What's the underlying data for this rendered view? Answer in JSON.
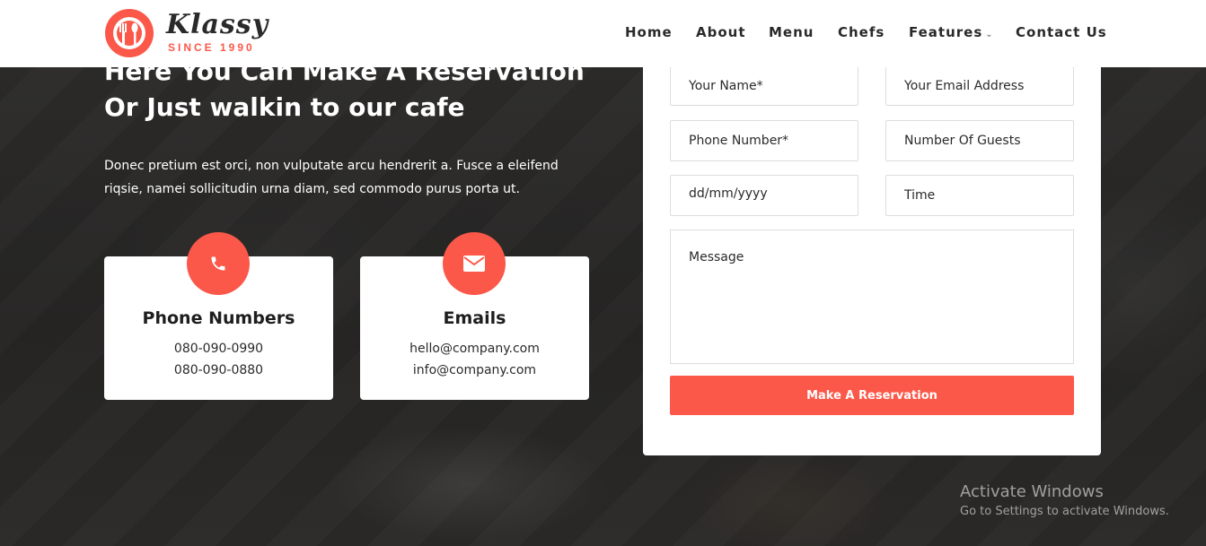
{
  "colors": {
    "accent": "#fb5849",
    "dark": "#2a2a2a",
    "white": "#ffffff"
  },
  "logo": {
    "name": "Klassy",
    "since": "SINCE 1990",
    "icon": "plate-fork-spoon-icon"
  },
  "nav": {
    "items": [
      {
        "label": "Home"
      },
      {
        "label": "About"
      },
      {
        "label": "Menu"
      },
      {
        "label": "Chefs"
      },
      {
        "label": "Features",
        "dropdown": true,
        "icon": "chevron-down-icon"
      },
      {
        "label": "Contact Us"
      }
    ]
  },
  "reservation": {
    "heading_line1": "Here You Can Make A Reservation",
    "heading_line2": "Or Just walkin to our cafe",
    "desc_line1": "Donec pretium est orci, non vulputate arcu hendrerit a. Fusce a eleifend",
    "desc_line2": "riqsie, namei sollicitudin urna diam, sed commodo purus porta ut."
  },
  "cards": [
    {
      "icon": "phone-icon",
      "title": "Phone Numbers",
      "lines": [
        "080-090-0990",
        "080-090-0880"
      ]
    },
    {
      "icon": "envelope-icon",
      "title": "Emails",
      "lines": [
        "hello@company.com",
        "info@company.com"
      ]
    }
  ],
  "form": {
    "name_placeholder": "Your Name*",
    "email_placeholder": "Your Email Address",
    "phone_placeholder": "Phone Number*",
    "guests_placeholder": "Number Of Guests",
    "date_placeholder": "dd/mm/yyyy",
    "time_placeholder": "Time",
    "message_placeholder": "Message",
    "submit_label": "Make A Reservation"
  },
  "os_overlay": {
    "title": "Activate Windows",
    "subtitle": "Go to Settings to activate Windows."
  }
}
